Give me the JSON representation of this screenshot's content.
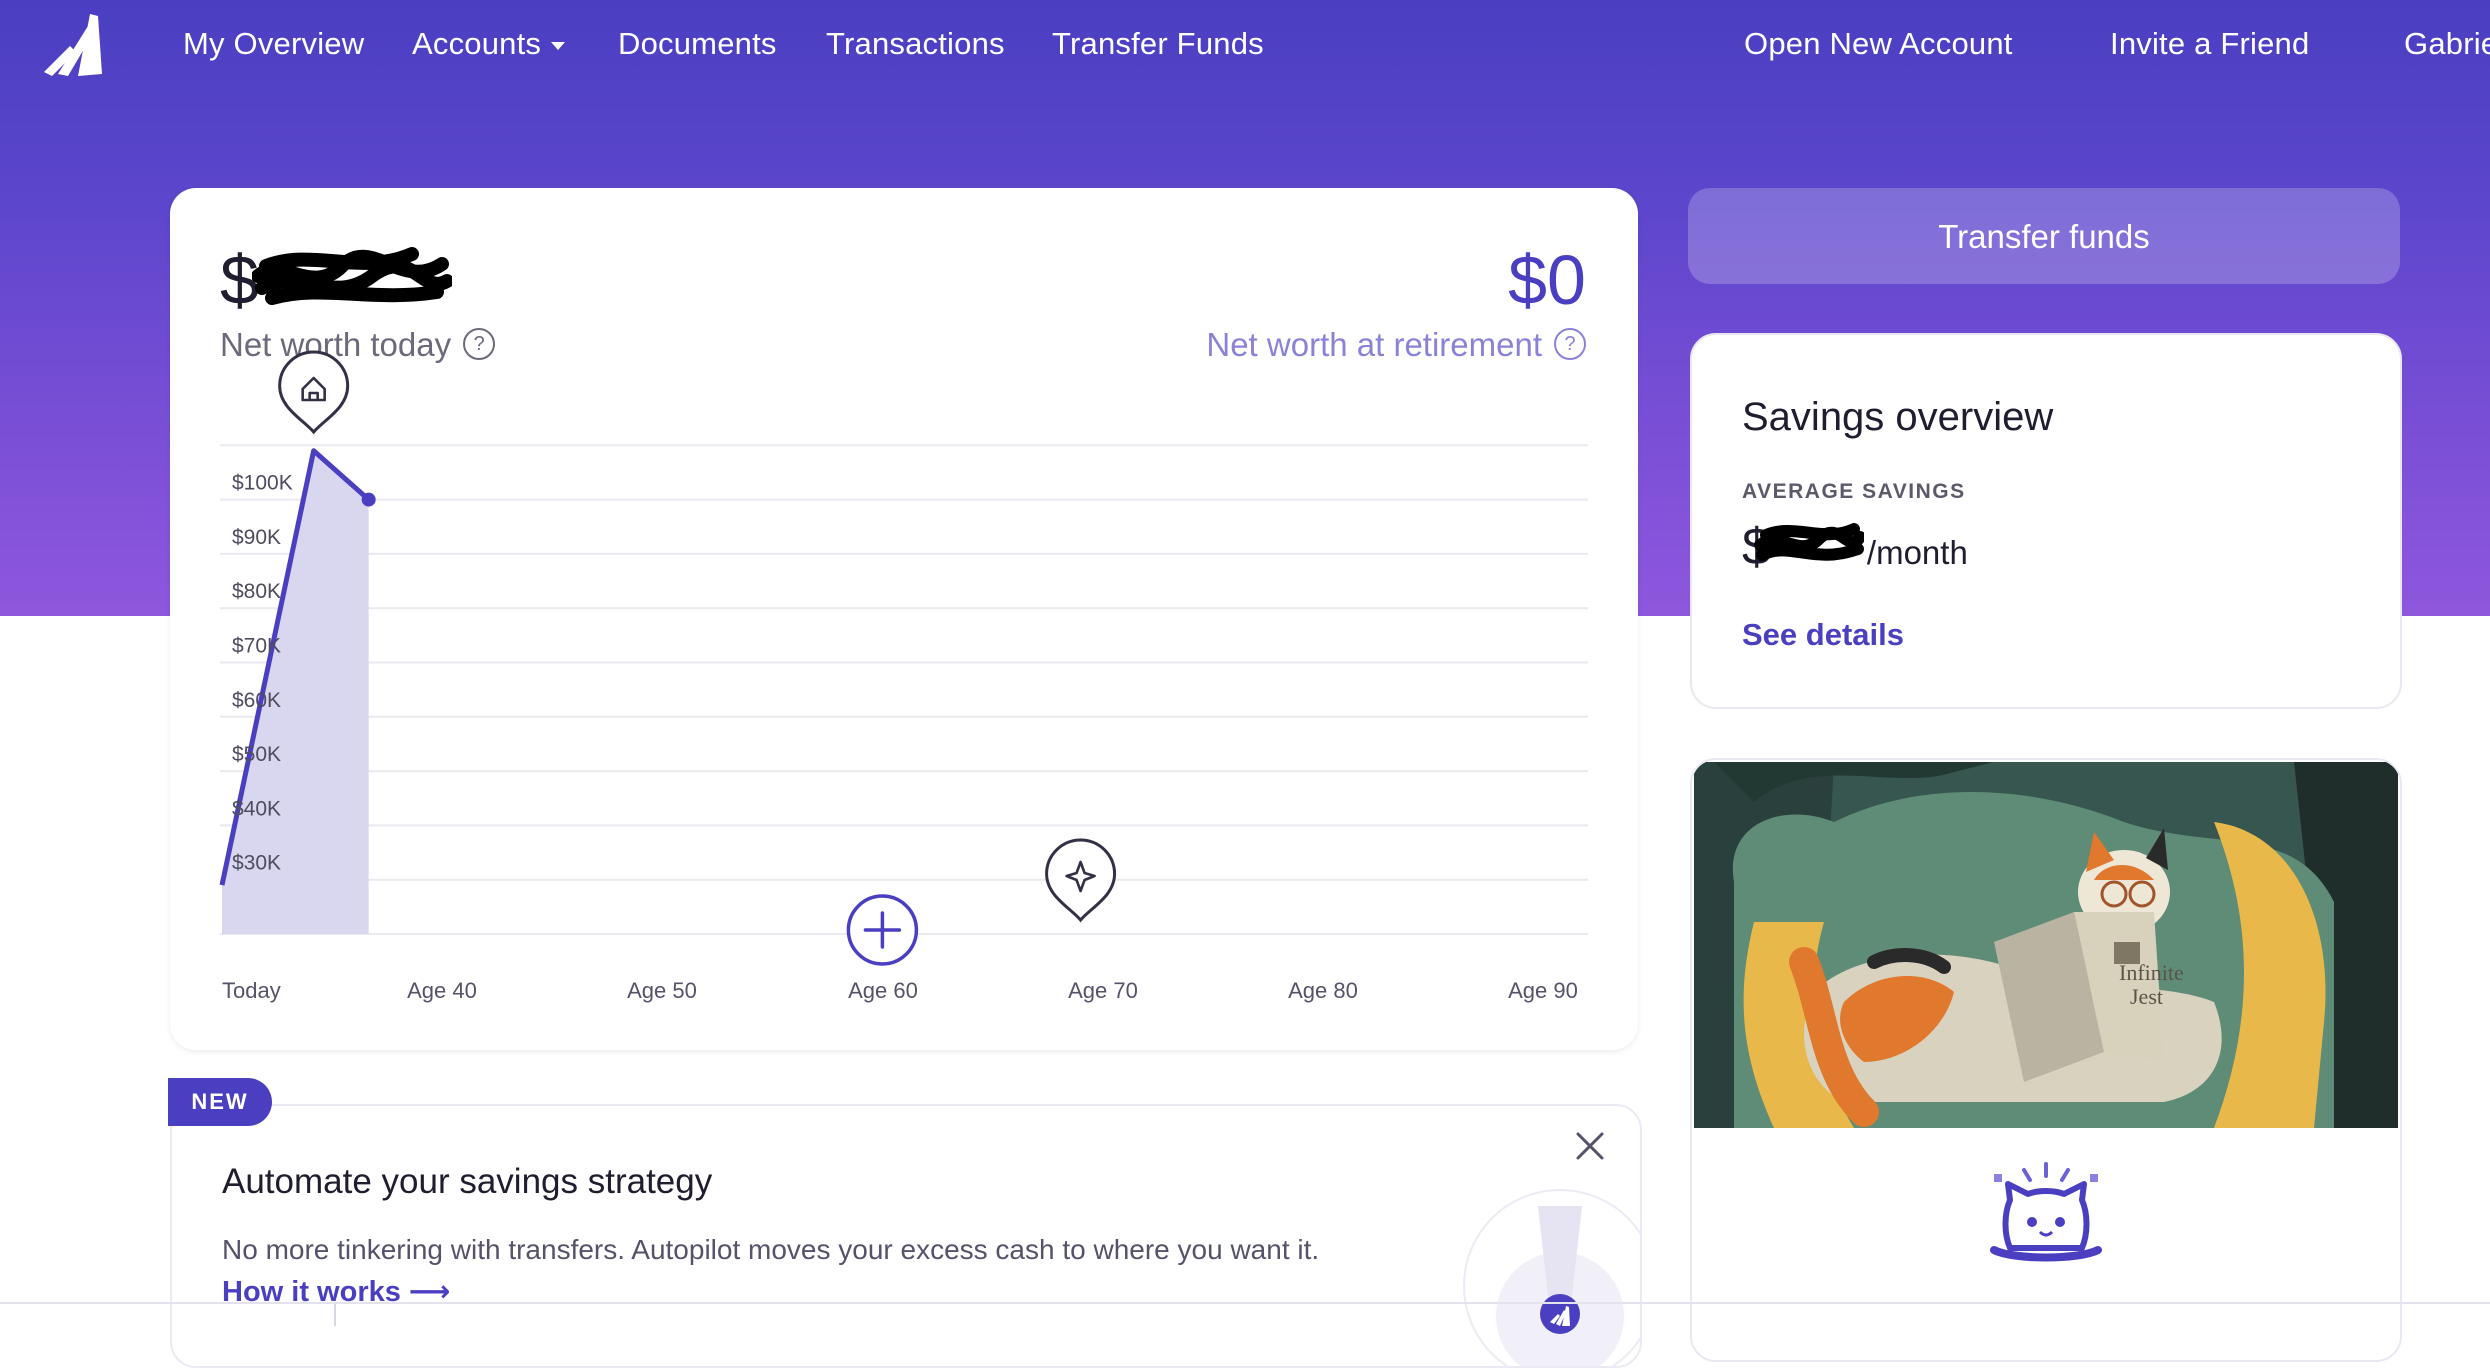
{
  "nav": {
    "items": [
      {
        "label": "My Overview"
      },
      {
        "label": "Accounts"
      },
      {
        "label": "Documents"
      },
      {
        "label": "Transactions"
      },
      {
        "label": "Transfer Funds"
      }
    ],
    "right_items": [
      {
        "label": "Open New Account"
      },
      {
        "label": "Invite a Friend"
      },
      {
        "label": "Gabrie"
      }
    ]
  },
  "net_worth": {
    "today_prefix": "$",
    "today_label": "Net worth today",
    "retirement_value": "$0",
    "retirement_label": "Net worth at retirement",
    "help_glyph": "?"
  },
  "chart_data": {
    "type": "area",
    "y_ticks": [
      "$30K",
      "$40K",
      "$50K",
      "$60K",
      "$70K",
      "$80K",
      "$90K",
      "$100K"
    ],
    "x_ticks": [
      "Today",
      "Age 40",
      "Age 50",
      "Age 60",
      "Age 70",
      "Age 80",
      "Age 90"
    ],
    "series": [
      {
        "x": [
          34,
          36.5,
          38
        ],
        "y": [
          29000,
          109000,
          100000
        ]
      }
    ],
    "ylim": [
      20000,
      110000
    ],
    "xlim": [
      34,
      90
    ],
    "grid": true,
    "markers": [
      {
        "icon": "home-pin-icon",
        "x": 36.5
      },
      {
        "icon": "add-goal-icon",
        "x": 60
      },
      {
        "icon": "sparkle-pin-icon",
        "x": 69
      }
    ],
    "colors": {
      "line": "#4b3fc1",
      "fill": "#d9d6f0",
      "grid": "#ebe9f0"
    }
  },
  "sidebar": {
    "transfer_button": "Transfer funds",
    "savings": {
      "title": "Savings overview",
      "avg_label": "AVERAGE SAVINGS",
      "currency": "$",
      "per_month": "/month",
      "link": "See details"
    }
  },
  "autopilot": {
    "badge": "NEW",
    "title": "Automate your savings strategy",
    "description": "No more tinkering with transfers. Autopilot moves your excess cash to where you want it.",
    "link": "How it works ⟶"
  },
  "theme": {
    "accent": "#4b3fc1",
    "hero_top": "#4a3fc1",
    "hero_bottom": "#8e57dc"
  }
}
